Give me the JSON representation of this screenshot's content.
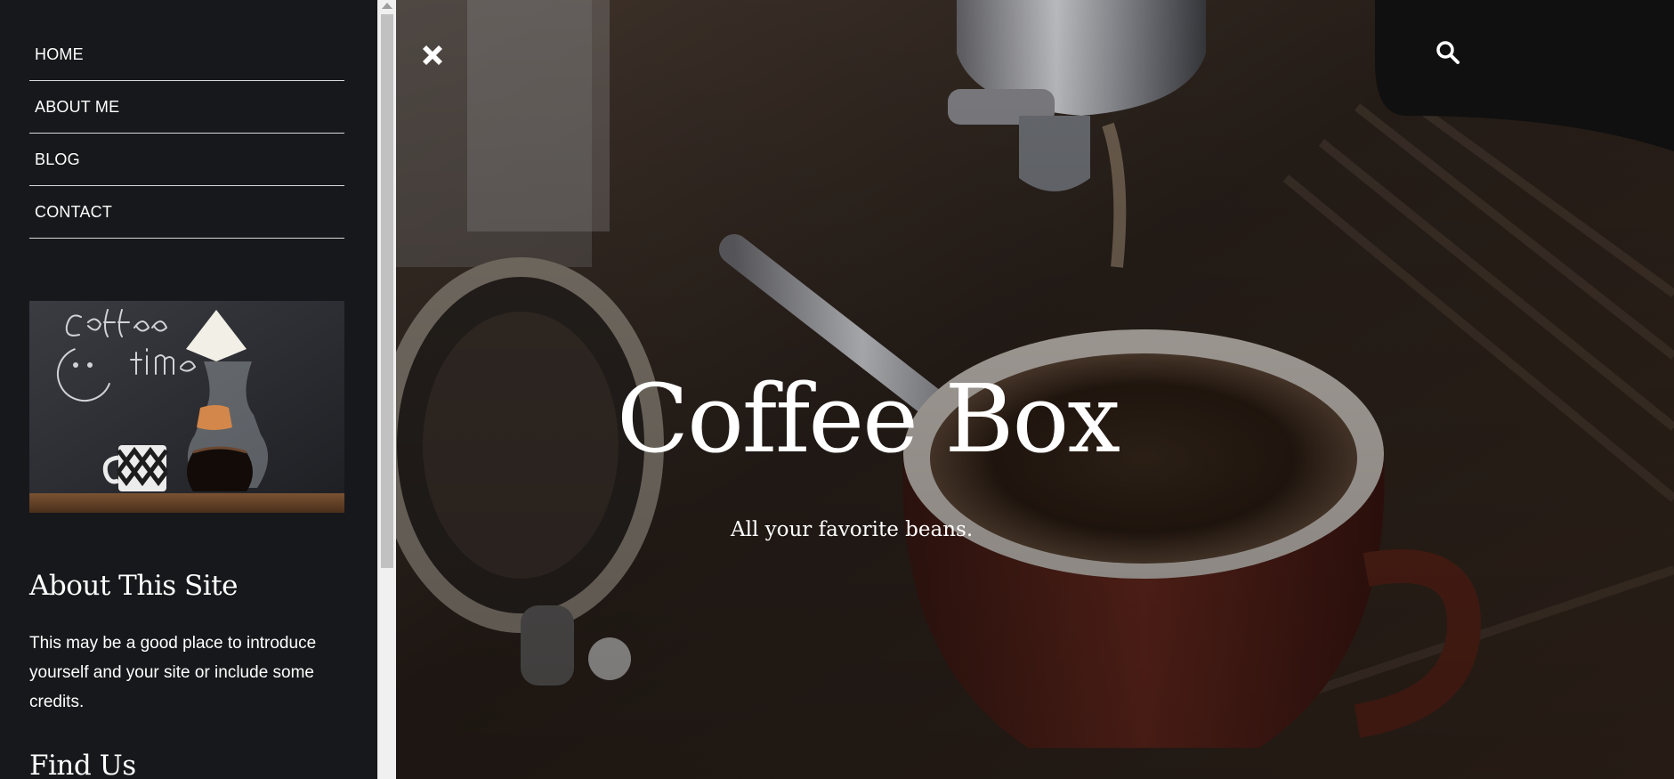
{
  "sidebar": {
    "nav": [
      {
        "label": "HOME"
      },
      {
        "label": "ABOUT ME"
      },
      {
        "label": "BLOG"
      },
      {
        "label": "CONTACT"
      }
    ],
    "widget_about": {
      "title": "About This Site",
      "text": "This may be a good place to introduce yourself and your site or include some credits."
    },
    "widget_find": {
      "title": "Find Us"
    },
    "image_chalk_text": "Coffee time"
  },
  "hero": {
    "title": "Coffee Box",
    "tagline": "All your favorite beans."
  },
  "icons": {
    "close": "close-icon",
    "search": "search-icon"
  },
  "colors": {
    "sidebar_bg": "#17181b",
    "text": "#ffffff",
    "divider": "#d9d9d9"
  }
}
